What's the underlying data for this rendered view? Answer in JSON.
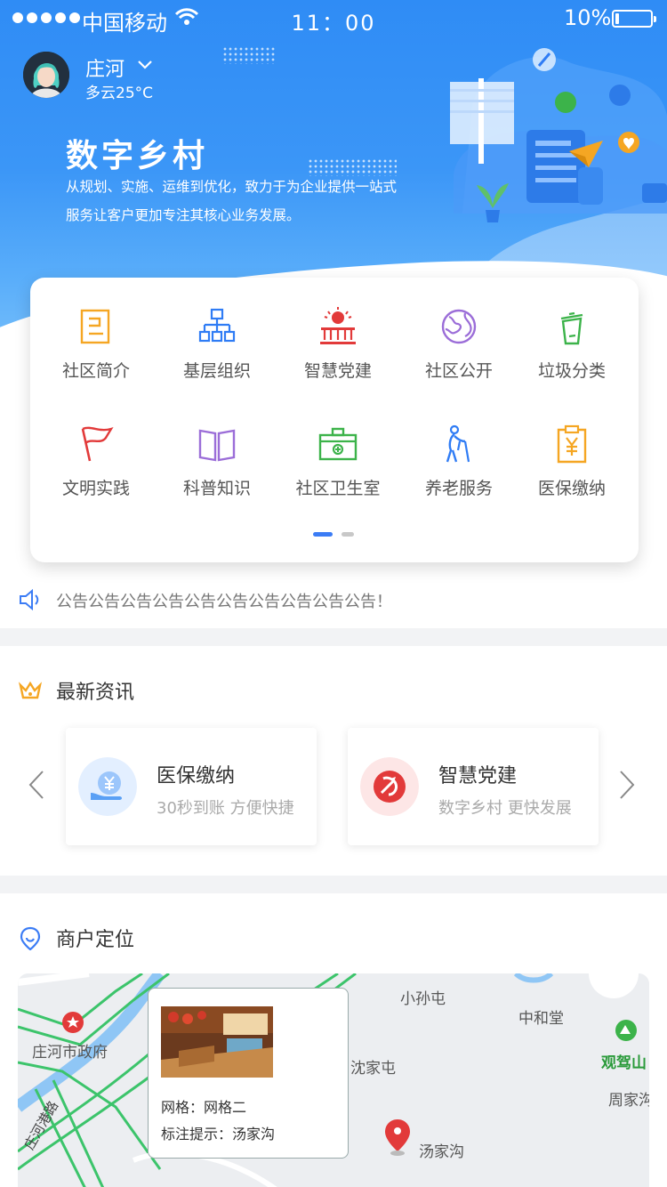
{
  "status_bar": {
    "carrier": "中国移动",
    "time": "11：00",
    "battery_percent": "10%",
    "battery_level": 0.1
  },
  "user": {
    "name": "庄河",
    "weather": "多云25°C"
  },
  "hero": {
    "title": "数字乡村",
    "description": "从规划、实施、运维到优化，致力于为企业提供一站式服务让客户更加专注其核心业务发展。"
  },
  "menu": {
    "items": [
      {
        "label": "社区简介",
        "icon": "document-icon",
        "color": "#f5a623"
      },
      {
        "label": "基层组织",
        "icon": "org-chart-icon",
        "color": "#2f7cf5"
      },
      {
        "label": "智慧党建",
        "icon": "party-building-icon",
        "color": "#e23a3a"
      },
      {
        "label": "社区公开",
        "icon": "globe-icon",
        "color": "#9b6dd8"
      },
      {
        "label": "垃圾分类",
        "icon": "trash-bin-icon",
        "color": "#3cb34a"
      },
      {
        "label": "文明实践",
        "icon": "flag-icon",
        "color": "#e23a3a"
      },
      {
        "label": "科普知识",
        "icon": "book-icon",
        "color": "#9b6dd8"
      },
      {
        "label": "社区卫生室",
        "icon": "medical-kit-icon",
        "color": "#3cb34a"
      },
      {
        "label": "养老服务",
        "icon": "elderly-icon",
        "color": "#2f7cf5"
      },
      {
        "label": "医保缴纳",
        "icon": "payment-clipboard-icon",
        "color": "#f5a623"
      }
    ],
    "page": 1,
    "page_count": 2
  },
  "notice": {
    "text": "公告公告公告公告公告公告公告公告公告公告！"
  },
  "news": {
    "title": "最新资讯",
    "cards": [
      {
        "title": "医保缴纳",
        "subtitle": "30秒到账  方便快捷",
        "icon": "yuan-hand-icon"
      },
      {
        "title": "智慧党建",
        "subtitle": "数字乡村  更快发展",
        "icon": "party-emblem-icon"
      }
    ]
  },
  "location": {
    "title": "商户定位",
    "map_labels": {
      "gov": "庄河市政府",
      "xiaosuntun": "小孙屯",
      "zhonghetang": "中和堂",
      "guanjiashan": "观驾山",
      "shenjiatun": "沈家屯",
      "zhoujia": "周家沟",
      "tangjiagou": "汤家沟",
      "road": "庄河港路"
    },
    "popup": {
      "grid": "网格：网格二",
      "hint": "标注提示：汤家沟"
    }
  }
}
